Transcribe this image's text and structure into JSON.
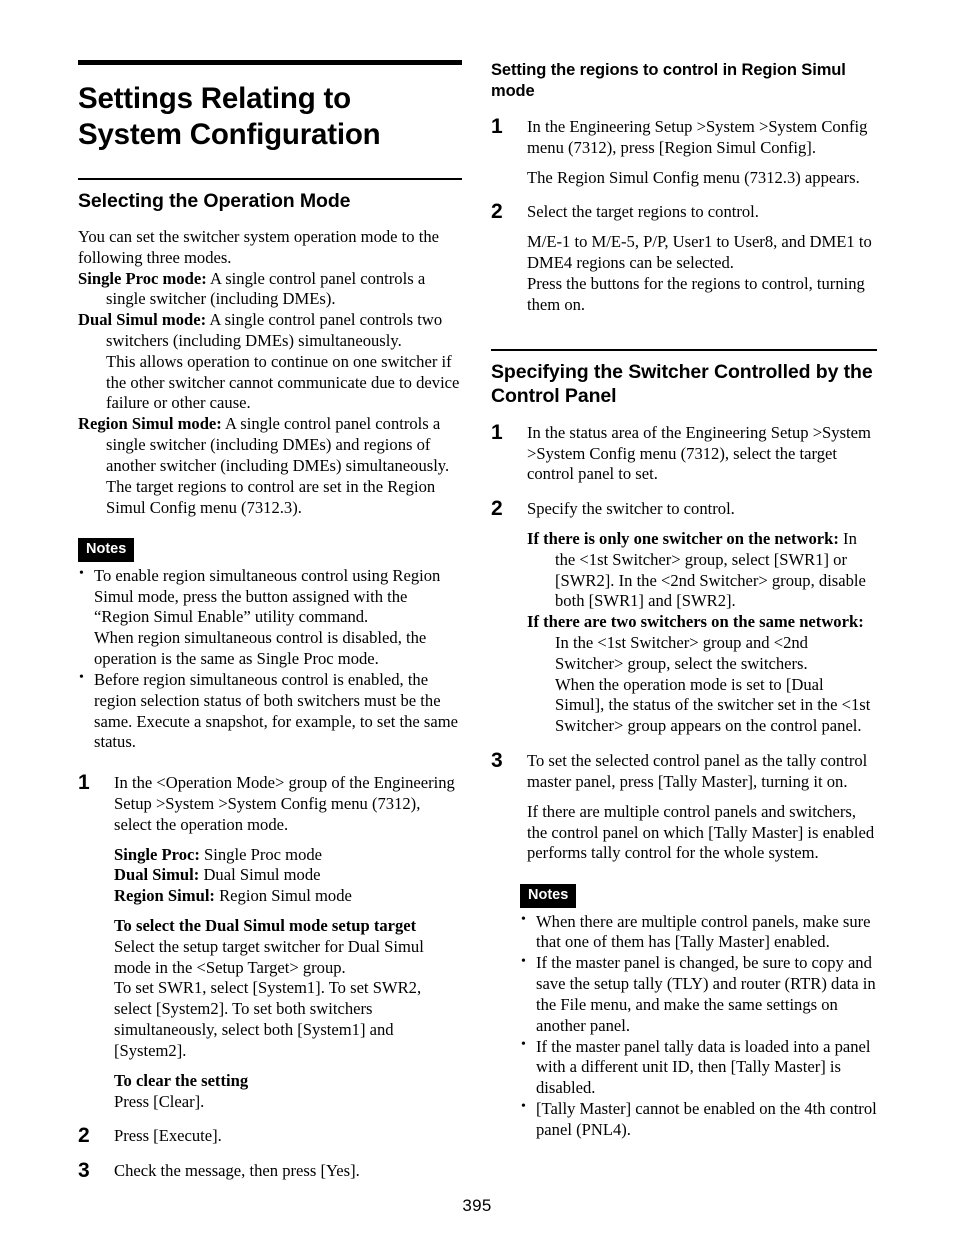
{
  "page": {
    "number": "395"
  },
  "left_column": {
    "title": "Settings Relating to System Configuration",
    "section": {
      "heading": "Selecting the Operation Mode",
      "intro": "You can set the switcher system operation mode to the following three modes.",
      "modes": [
        {
          "term": "Single Proc mode:",
          "definition": " A single control panel controls a single switcher (including DMEs)."
        },
        {
          "term": "Dual Simul mode:",
          "definition": " A single control panel controls two switchers (including DMEs) simultaneously.",
          "continuation": "This allows operation to continue on one switcher if the other switcher cannot communicate due to device failure or other cause."
        },
        {
          "term": "Region Simul mode:",
          "definition": " A single control panel controls a single switcher (including DMEs) and regions of another switcher (including DMEs) simultaneously.",
          "continuation": "The target regions to control are set in the Region Simul Config menu (7312.3)."
        }
      ],
      "notes_label": "Notes",
      "notes": [
        "To enable region simultaneous control using Region Simul mode, press the button assigned with the “Region Simul Enable” utility command.\nWhen region simultaneous control is disabled, the operation is the same as Single Proc mode.",
        "Before region simultaneous control is enabled, the region selection status of both switchers must be the same. Execute a snapshot, for example, to set the same status."
      ],
      "steps": [
        {
          "number": "1",
          "text": "In the <Operation Mode> group of the Engineering Setup >System >System Config menu (7312), select the operation mode.",
          "definitions": [
            {
              "term": "Single Proc:",
              "value": " Single Proc mode"
            },
            {
              "term": "Dual Simul:",
              "value": " Dual Simul mode"
            },
            {
              "term": "Region Simul:",
              "value": " Region Simul mode"
            }
          ],
          "sub_heading_1": "To select the Dual Simul mode setup target",
          "sub_body_1": "Select the setup target switcher for Dual Simul mode in the <Setup Target> group.\nTo set SWR1, select [System1]. To set SWR2, select [System2]. To set both switchers simultaneously, select both [System1] and [System2].",
          "sub_heading_2": "To clear the setting",
          "sub_body_2": "Press [Clear]."
        },
        {
          "number": "2",
          "text": "Press [Execute]."
        },
        {
          "number": "3",
          "text": "Check the message, then press [Yes]."
        }
      ]
    }
  },
  "right_column": {
    "subsection_1": {
      "heading": "Setting the regions to control in Region Simul mode",
      "steps": [
        {
          "number": "1",
          "text": "In the Engineering Setup >System >System Config menu (7312), press [Region Simul Config].",
          "result": "The Region Simul Config menu (7312.3) appears."
        },
        {
          "number": "2",
          "text": "Select the target regions to control.",
          "result": "M/E-1 to M/E-5, P/P, User1 to User8, and DME1 to DME4 regions can be selected.\nPress the buttons for the regions to control, turning them on."
        }
      ]
    },
    "section_2": {
      "heading": "Specifying the Switcher Controlled by the Control Panel",
      "steps": [
        {
          "number": "1",
          "text": "In the status area of the Engineering Setup >System >System Config menu (7312), select the target control panel to set."
        },
        {
          "number": "2",
          "text": "Specify the switcher to control.",
          "cases": [
            {
              "term": "If there is only one switcher on the network:",
              "value": " In the <1st Switcher> group, select [SWR1] or [SWR2]. In the <2nd Switcher> group, disable both [SWR1] and [SWR2]."
            },
            {
              "term": "If there are two switchers on the same network:",
              "value": " In the <1st Switcher> group and <2nd Switcher> group, select the switchers.",
              "continuation": "When the operation mode is set to [Dual Simul], the status of the switcher set in the <1st Switcher> group appears on the control panel."
            }
          ]
        },
        {
          "number": "3",
          "text": "To set the selected control panel as the tally control master panel, press [Tally Master], turning it on.",
          "result": "If there are multiple control panels and switchers, the control panel on which [Tally Master] is enabled performs tally control for the whole system."
        }
      ],
      "notes_label": "Notes",
      "notes": [
        "When there are multiple control panels, make sure that one of them has [Tally Master] enabled.",
        "If the master panel is changed, be sure to copy and save the setup tally (TLY) and router (RTR) data in the File menu, and make the same settings on another panel.",
        "If the master panel tally data is loaded into a panel with a different unit ID, then [Tally Master] is disabled.",
        "[Tally Master] cannot be enabled on the 4th control panel (PNL4)."
      ]
    }
  }
}
